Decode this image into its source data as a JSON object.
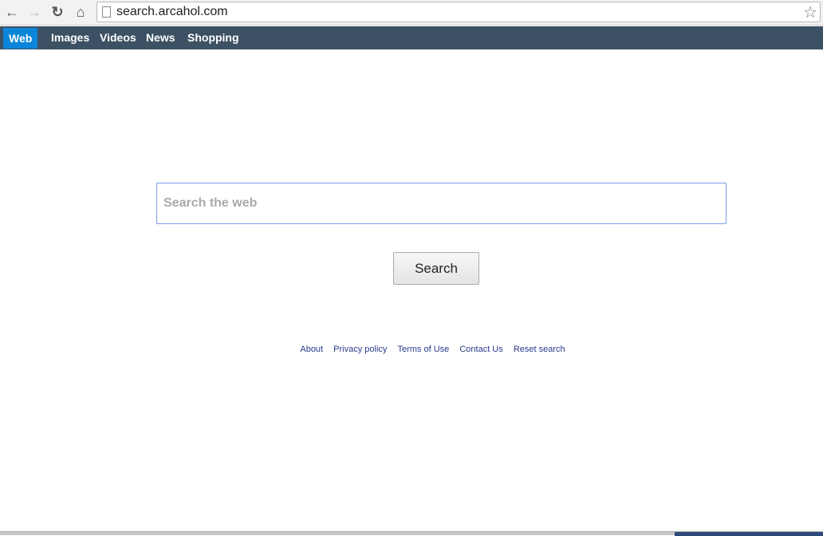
{
  "browser": {
    "url": "search.arcahol.com",
    "back": "back-icon",
    "forward": "forward-icon",
    "reload": "reload-icon",
    "home": "home-icon",
    "bookmark": "star-icon"
  },
  "nav": {
    "items": [
      {
        "label": "Web",
        "active": true
      },
      {
        "label": "Images"
      },
      {
        "label": "Videos"
      },
      {
        "label": "News"
      },
      {
        "label": "Shopping"
      }
    ],
    "bg": "#3c5163",
    "accent": "#0b86d8"
  },
  "search": {
    "placeholder": "Search the web",
    "value": "",
    "button": "Search"
  },
  "footer": {
    "links": [
      "About",
      "Privacy policy",
      "Terms of Use",
      "Contact Us",
      "Reset search"
    ]
  }
}
